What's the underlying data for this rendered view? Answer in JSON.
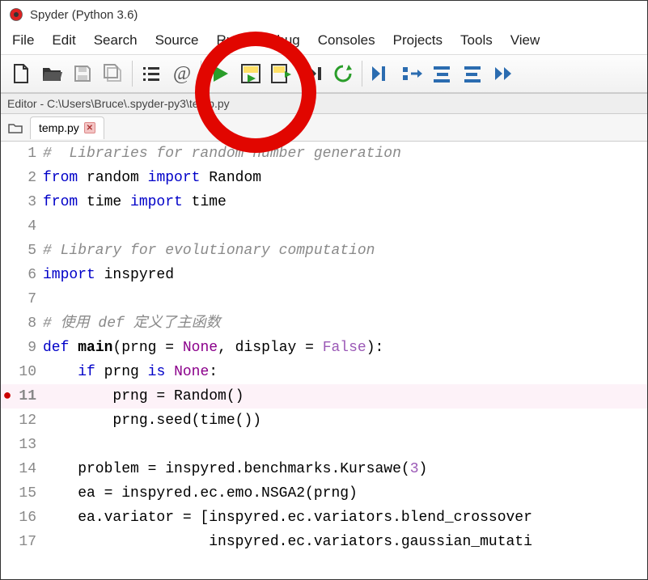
{
  "window": {
    "title": "Spyder (Python 3.6)"
  },
  "menu": {
    "file": "File",
    "edit": "Edit",
    "search": "Search",
    "source": "Source",
    "run": "Run",
    "debug": "Debug",
    "consoles": "Consoles",
    "projects": "Projects",
    "tools": "Tools",
    "view": "View"
  },
  "editor_path": "Editor - C:\\Users\\Bruce\\.spyder-py3\\temp.py",
  "tab": {
    "label": "temp.py"
  },
  "code_lines": [
    {
      "n": 1,
      "bp": false,
      "html": "<span class='c-comment'>#  Libraries for random number generation</span>"
    },
    {
      "n": 2,
      "bp": false,
      "html": "<span class='c-kw'>from</span> random <span class='c-kw'>import</span> Random"
    },
    {
      "n": 3,
      "bp": false,
      "html": "<span class='c-kw'>from</span> time <span class='c-kw'>import</span> time"
    },
    {
      "n": 4,
      "bp": false,
      "html": " "
    },
    {
      "n": 5,
      "bp": false,
      "html": "<span class='c-comment'># Library for evolutionary computation</span>"
    },
    {
      "n": 6,
      "bp": false,
      "html": "<span class='c-kw'>import</span> inspyred"
    },
    {
      "n": 7,
      "bp": false,
      "html": " "
    },
    {
      "n": 8,
      "bp": false,
      "html": "<span class='c-comment'># 使用 def 定义了主函数</span>"
    },
    {
      "n": 9,
      "bp": false,
      "html": "<span class='c-def'>def</span> <span class='c-fn'>main</span>(prng = <span class='c-builtin'>None</span>, display = <span class='c-const'>False</span>):"
    },
    {
      "n": 10,
      "bp": false,
      "html": "    <span class='c-kw'>if</span> prng <span class='c-kw'>is</span> <span class='c-builtin'>None</span>:"
    },
    {
      "n": 11,
      "bp": true,
      "html": "        prng = Random()"
    },
    {
      "n": 12,
      "bp": false,
      "html": "        prng.seed(time())"
    },
    {
      "n": 13,
      "bp": false,
      "html": " "
    },
    {
      "n": 14,
      "bp": false,
      "html": "    problem = inspyred.benchmarks.Kursawe(<span class='c-num'>3</span>)"
    },
    {
      "n": 15,
      "bp": false,
      "html": "    ea = inspyred.ec.emo.NSGA2(prng)"
    },
    {
      "n": 16,
      "bp": false,
      "html": "    ea.variator = [inspyred.ec.variators.blend_crossover"
    },
    {
      "n": 17,
      "bp": false,
      "html": "                   inspyred.ec.variators.gaussian_mutati"
    }
  ],
  "breakpoint_line": 11
}
